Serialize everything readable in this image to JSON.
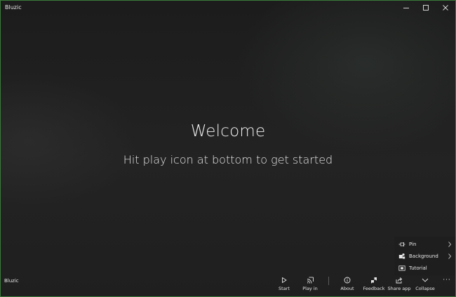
{
  "window": {
    "title": "Bluzic",
    "controls": [
      "minimize-icon",
      "maximize-icon",
      "close-icon"
    ]
  },
  "main": {
    "heading": "Welcome",
    "subtitle": "Hit play icon at bottom to get started"
  },
  "flyout": {
    "items": [
      {
        "label": "Pin",
        "icon": "pin-icon",
        "has_submenu": true
      },
      {
        "label": "Background",
        "icon": "background-icon",
        "has_submenu": true
      },
      {
        "label": "Tutorial",
        "icon": "tutorial-icon",
        "has_submenu": false
      }
    ]
  },
  "command_bar": {
    "app_label": "Bluzic",
    "buttons": [
      {
        "label": "Start",
        "icon": "play-icon"
      },
      {
        "label": "Play in",
        "icon": "cast-icon"
      },
      {
        "label": "About",
        "icon": "info-icon"
      },
      {
        "label": "Feedback",
        "icon": "feedback-icon"
      },
      {
        "label": "Share app",
        "icon": "share-icon"
      },
      {
        "label": "Collapse",
        "icon": "chevron-down-icon"
      }
    ],
    "more_glyph": "···"
  },
  "colors": {
    "background": "#1b1b1b",
    "window_border": "#3a7a3a",
    "text": "#ffffff"
  }
}
